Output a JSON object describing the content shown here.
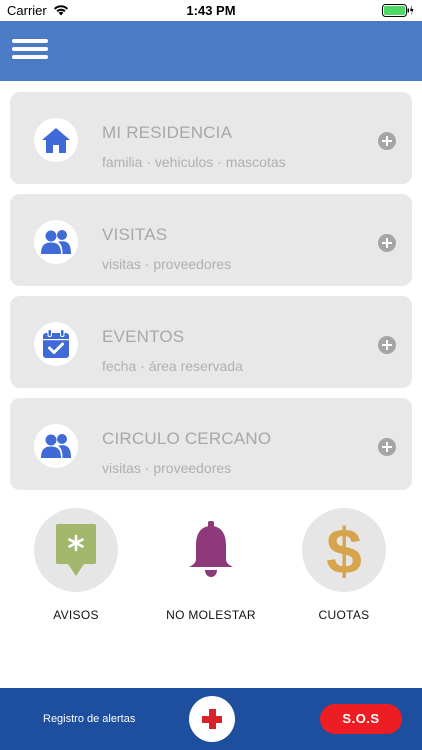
{
  "status_bar": {
    "carrier": "Carrier",
    "time": "1:43 PM",
    "battery_color": "#4cd964"
  },
  "header": {
    "color": "#4c7bc6",
    "menu_icon": "hamburger-menu-icon"
  },
  "cards": [
    {
      "title": "MI RESIDENCIA",
      "subtitle": "familia · vehiculos · mascotas",
      "icon": "home-icon"
    },
    {
      "title": "VISITAS",
      "subtitle": "visitas · proveedores",
      "icon": "people-icon"
    },
    {
      "title": "EVENTOS",
      "subtitle": "fecha · área reservada",
      "icon": "calendar-check-icon"
    },
    {
      "title": "CIRCULO CERCANO",
      "subtitle": "visitas · proveedores",
      "icon": "people-icon"
    }
  ],
  "actions": [
    {
      "label": "AVISOS",
      "icon": "notice-icon",
      "color": "#a3b76c"
    },
    {
      "label": "NO  MOLESTAR",
      "icon": "bell-icon",
      "color": "#8e3a7a"
    },
    {
      "label": "CUOTAS",
      "icon": "dollar-icon",
      "color": "#d6a44a"
    }
  ],
  "bottom_bar": {
    "registro_label": "Registro de alertas",
    "sos_label": "S.O.S",
    "color": "#1d4f9e",
    "sos_color": "#ee1d24",
    "cross_icon": "red-cross-icon"
  },
  "colors": {
    "icon_blue": "#3f6ad8",
    "card_bg": "#e8e8e8"
  }
}
